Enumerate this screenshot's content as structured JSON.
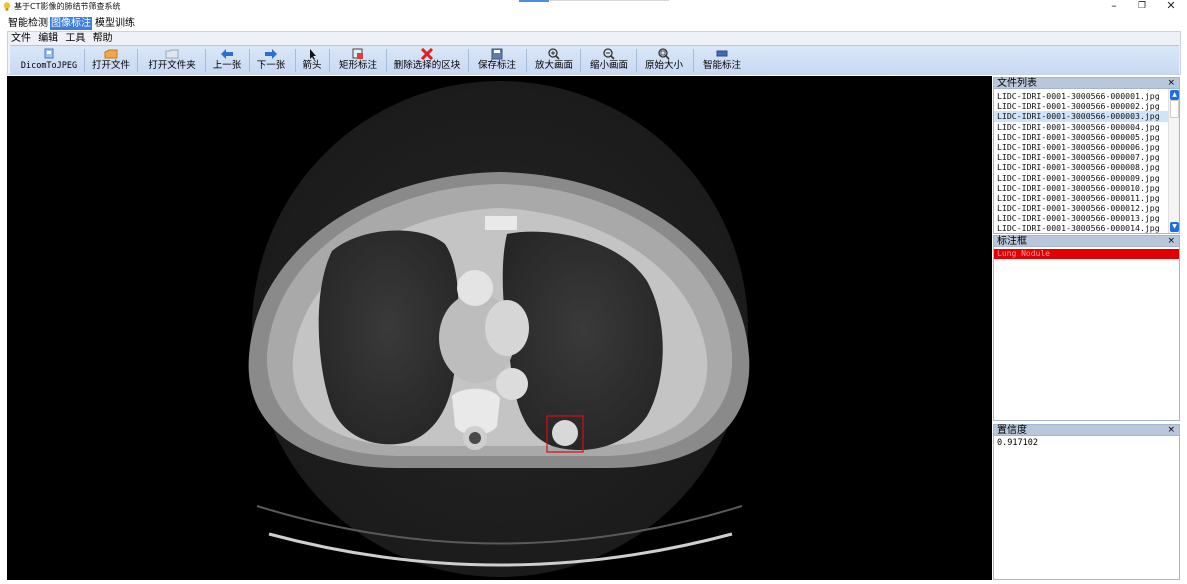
{
  "window": {
    "title": "基于CT影像的肺结节筛查系统",
    "minimize": "–",
    "maximize": "❐",
    "close": "✕"
  },
  "top_tabs": [
    "智能检测",
    "图像标注",
    "模型训练"
  ],
  "active_tab_index": 1,
  "menu": [
    "文件",
    "编辑",
    "工具",
    "帮助"
  ],
  "toolbar": {
    "dicom_to_jpeg": "DicomToJPEG",
    "open_file": "打开文件",
    "open_folder": "打开文件夹",
    "prev": "上一张",
    "next": "下一张",
    "arrow": "箭头",
    "rect_annotate": "矩形标注",
    "delete_region": "删除选择的区块",
    "save_annotation": "保存标注",
    "zoom_in": "放大画面",
    "zoom_out": "缩小画面",
    "original_size": "原始大小",
    "smart_annotate": "智能标注"
  },
  "file_list": {
    "title": "文件列表",
    "close": "×",
    "selected_index": 2,
    "files": [
      "LIDC-IDRI-0001-3000566-000001.jpg",
      "LIDC-IDRI-0001-3000566-000002.jpg",
      "LIDC-IDRI-0001-3000566-000003.jpg",
      "LIDC-IDRI-0001-3000566-000004.jpg",
      "LIDC-IDRI-0001-3000566-000005.jpg",
      "LIDC-IDRI-0001-3000566-000006.jpg",
      "LIDC-IDRI-0001-3000566-000007.jpg",
      "LIDC-IDRI-0001-3000566-000008.jpg",
      "LIDC-IDRI-0001-3000566-000009.jpg",
      "LIDC-IDRI-0001-3000566-000010.jpg",
      "LIDC-IDRI-0001-3000566-000011.jpg",
      "LIDC-IDRI-0001-3000566-000012.jpg",
      "LIDC-IDRI-0001-3000566-000013.jpg",
      "LIDC-IDRI-0001-3000566-000014.jpg"
    ]
  },
  "annotation_box": {
    "title": "标注框",
    "close": "×",
    "items": [
      "Lung Nodule"
    ]
  },
  "confidence": {
    "title": "置信度",
    "close": "×",
    "value": "0.917102"
  },
  "colors": {
    "accent": "#3b7de0",
    "annotation_red": "#e30000",
    "toolbar_bg": "#cfe0f7"
  }
}
